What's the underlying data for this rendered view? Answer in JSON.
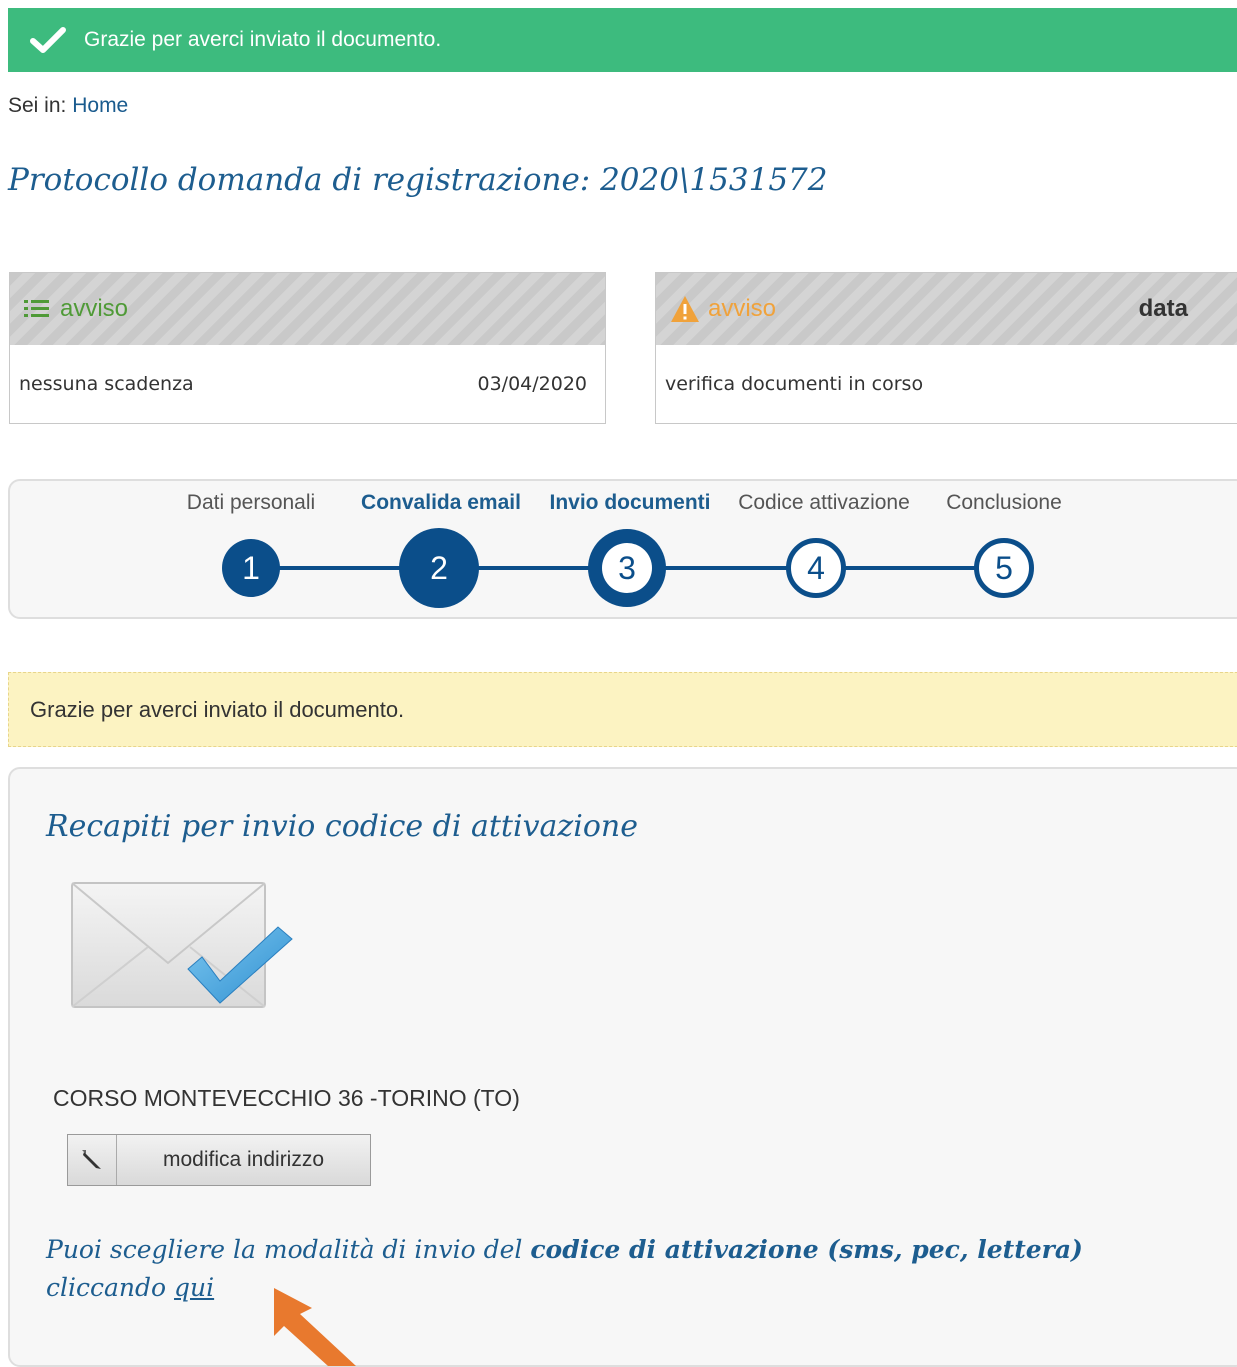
{
  "banner": {
    "message": "Grazie per averci inviato il documento."
  },
  "breadcrumb": {
    "prefix": "Sei in:",
    "home": "Home"
  },
  "page_title": "Protocollo domanda di registrazione: 2020\\1531572",
  "cards": [
    {
      "icon": "list-icon",
      "header": "avviso",
      "header_color": "#4f9a37",
      "text": "nessuna scadenza",
      "date": "03/04/2020"
    },
    {
      "icon": "warning-icon",
      "header": "avviso",
      "header_color": "#f0a23b",
      "header_right": "data",
      "text": "verifica documenti in corso"
    }
  ],
  "stepper": {
    "steps": [
      {
        "label": "Dati personali",
        "number": "1",
        "state": "completed"
      },
      {
        "label": "Convalida email",
        "number": "2",
        "state": "completed"
      },
      {
        "label": "Invio documenti",
        "number": "3",
        "state": "current"
      },
      {
        "label": "Codice attivazione",
        "number": "4",
        "state": "pending"
      },
      {
        "label": "Conclusione",
        "number": "5",
        "state": "pending"
      }
    ],
    "color": "#0b4e8a"
  },
  "notice": {
    "text": "Grazie per averci inviato il documento."
  },
  "panel": {
    "title": "Recapiti per invio codice di attivazione",
    "address": "CORSO MONTEVECCHIO 36 -TORINO (TO)",
    "edit_button": "modifica indirizzo",
    "info_prefix": "Puoi scegliere la modalità di invio del ",
    "info_bold": "codice di attivazione (sms, pec, lettera)",
    "info_middle": "cliccando ",
    "info_link": "qui"
  },
  "colors": {
    "banner_green": "#3dbb7e",
    "title_blue": "#1d5d8f",
    "notice_yellow": "#fcf3c2",
    "arrow_orange": "#e8792e"
  }
}
